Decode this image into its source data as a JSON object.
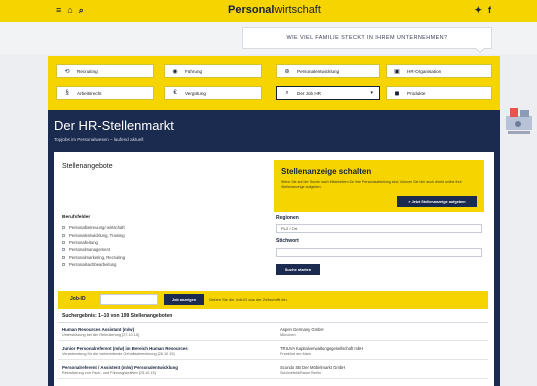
{
  "topbar": {
    "brand_bold": "Personal",
    "brand_rest": "wirtschaft",
    "menu_icon": "menu-icon",
    "home_icon": "home-icon",
    "search_icon": "search-icon",
    "twitter_icon": "twitter-icon",
    "facebook_icon": "facebook-icon"
  },
  "banner": {
    "text": "WIE VIEL FAMILIE STECKT IN IHREM UNTERNEHMEN?"
  },
  "nav": {
    "items": [
      {
        "label": "Recruiting",
        "icon": "recruiting-icon",
        "glyph": "⟲"
      },
      {
        "label": "Führung",
        "icon": "leadership-icon",
        "glyph": "◉"
      },
      {
        "label": "Personalentwicklung",
        "icon": "development-icon",
        "glyph": "⊛"
      },
      {
        "label": "HR-Organisation",
        "icon": "organisation-icon",
        "glyph": "▣"
      },
      {
        "label": "Arbeitsrecht",
        "icon": "paragraph-icon",
        "glyph": "§"
      },
      {
        "label": "Vergütung",
        "icon": "euro-icon",
        "glyph": "€"
      },
      {
        "label": "Der Job HR",
        "icon": "job-icon",
        "glyph": "⌕"
      },
      {
        "label": "Produkte",
        "icon": "products-icon",
        "glyph": "◼"
      }
    ]
  },
  "hero": {
    "title": "Der HR-Stellenmarkt",
    "subtitle": "Topjobs im Personalwesen – laufend aktuell"
  },
  "main": {
    "section_title": "Stellenangebote",
    "promo": {
      "title": "Stellenanzeige schalten",
      "text": "Wenn Sie auf der Suche nach Mitarbeitern für Ihre Personalabteilung sind, können Sie hier auch direkt online Ihre Stellenanzeige aufgeben.",
      "button": "» Jetzt Stellenanzeige aufgeben"
    },
    "berufsfelder": {
      "label": "Berufsfelder",
      "items": [
        "Personalbetreuung/-wirtschaft",
        "Personalentwicklung, Training",
        "Personalleitung",
        "Personalmanagement",
        "Personalmarketing, Recruiting",
        "Personalsachbearbeitung"
      ]
    },
    "regionen": {
      "label": "Regionen",
      "value": "PLZ / Ort"
    },
    "stichwort": {
      "label": "Stichwort",
      "value": ""
    },
    "search_button": "Suche starten",
    "jobid": {
      "label": "Job-ID",
      "button": "Job anzeigen",
      "hint": "Geben Sie die Job-ID aus der Zeitschrift ein."
    },
    "results": {
      "title": "Suchergebnis: 1–10 von 199 Stellenangeboten",
      "rows": [
        {
          "title": "Human Resources Assistant (m/w)",
          "sub": "Unterstützung bei der Rekrutierung [27.10.15]",
          "company": "Aspen Germany GmbH",
          "city": "München"
        },
        {
          "title": "Junior Personalreferent (m/w) im Bereich Human Resources",
          "sub": "Verantwortung für die vorbereitende Gehaltsabrechnung [26.10.15]",
          "company": "TRIUVA Kapitalverwaltungsgesellschaft mbH",
          "city": "Frankfurt am Main"
        },
        {
          "title": "Personalreferent / Assistent (m/w) Personalentwicklung",
          "sub": "Rekrutierung von Fach- und Führungskräften [23.10.15]",
          "company": "Scondo SB Der Möbelmarkt GmbH",
          "city": "Schönefeld/Raum Berlin"
        }
      ]
    }
  }
}
